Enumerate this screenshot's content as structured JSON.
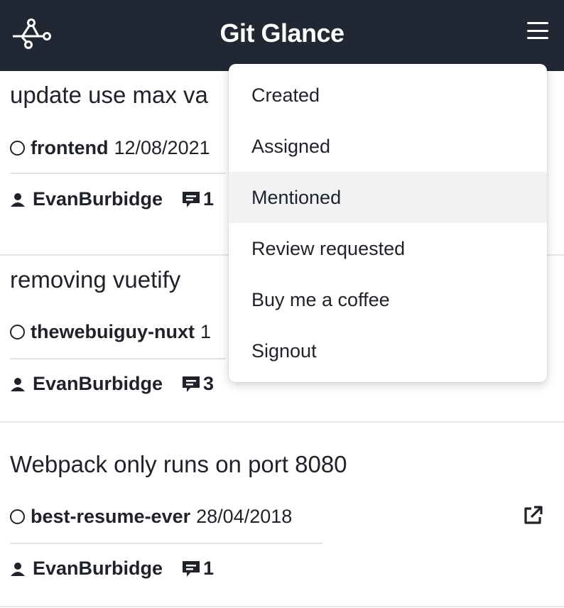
{
  "app": {
    "title": "Git Glance",
    "logo_icon": "git-branch-icon",
    "menu_icon": "hamburger-icon",
    "navbar_color": "#222833"
  },
  "menu": {
    "items": [
      {
        "label": "Created"
      },
      {
        "label": "Assigned"
      },
      {
        "label": "Mentioned",
        "highlighted": true
      },
      {
        "label": "Review requested"
      },
      {
        "label": "Buy me a coffee"
      },
      {
        "label": "Signout"
      }
    ]
  },
  "issues": [
    {
      "title": "update use max va",
      "repo": "frontend",
      "date": "12/08/2021",
      "author": "EvanBurbidge",
      "comments": "1"
    },
    {
      "title": "removing vuetify",
      "repo": "thewebuiguy-nuxt",
      "date": "1",
      "author": "EvanBurbidge",
      "comments": "3"
    },
    {
      "title": "Webpack only runs on port 8080",
      "repo": "best-resume-ever",
      "date": "28/04/2018",
      "author": "EvanBurbidge",
      "comments": "1",
      "external_link_icon": "external-link-icon"
    }
  ]
}
